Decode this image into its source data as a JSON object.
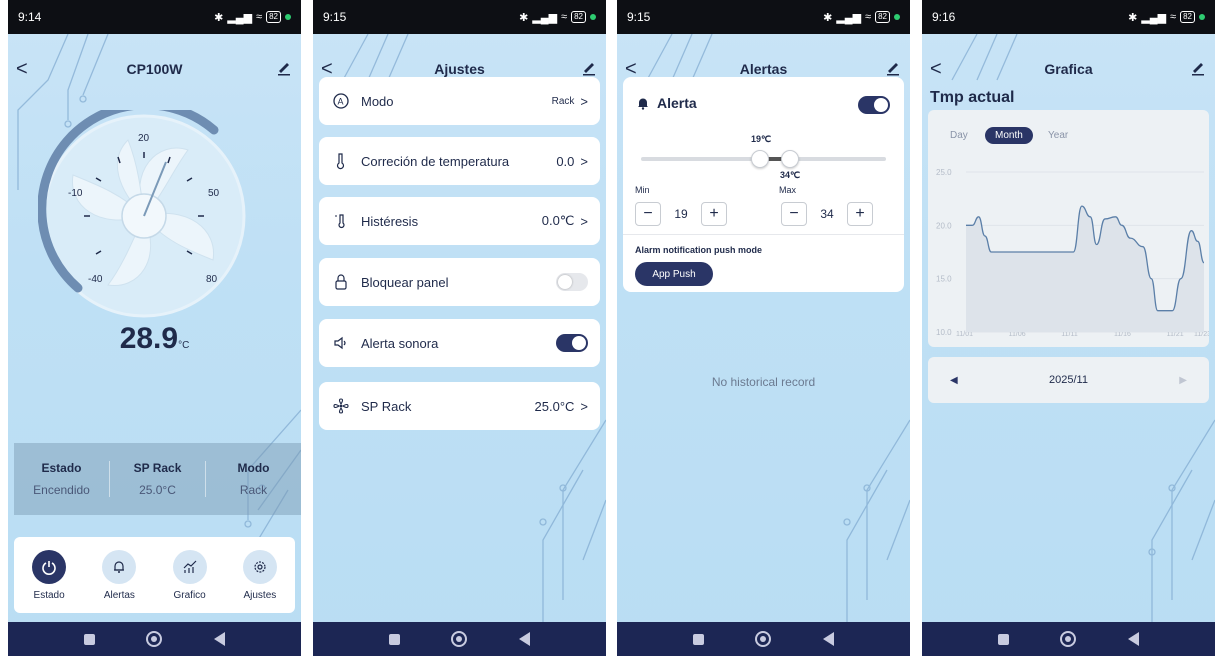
{
  "screens": [
    {
      "status": {
        "time": "9:14",
        "battery": "82"
      },
      "title": "CP100W",
      "dial": {
        "value": "28.9",
        "unit": "°C",
        "ticks": [
          "20",
          "-10",
          "50",
          "-40",
          "80"
        ]
      },
      "info": [
        {
          "label": "Estado",
          "value": "Encendido"
        },
        {
          "label": "SP Rack",
          "value": "25.0°C"
        },
        {
          "label": "Modo",
          "value": "Rack"
        }
      ],
      "tabs": [
        {
          "label": "Estado",
          "icon": "power-icon",
          "active": true
        },
        {
          "label": "Alertas",
          "icon": "bell-icon",
          "active": false
        },
        {
          "label": "Grafico",
          "icon": "chart-icon",
          "active": false
        },
        {
          "label": "Ajustes",
          "icon": "gear-icon",
          "active": false
        }
      ]
    },
    {
      "status": {
        "time": "9:15",
        "battery": "82"
      },
      "title": "Ajustes",
      "settings": [
        {
          "label": "Modo",
          "value": "Rack",
          "icon": "mode-icon",
          "type": "link"
        },
        {
          "label": "Correción de temperatura",
          "value": "0.0",
          "icon": "temperature-icon",
          "type": "link"
        },
        {
          "label": "Histéresis",
          "value": "0.0℃",
          "icon": "hysteresis-icon",
          "type": "link"
        },
        {
          "label": "Bloquear panel",
          "icon": "lock-icon",
          "type": "toggle",
          "on": false
        },
        {
          "label": "Alerta sonora",
          "icon": "speaker-icon",
          "type": "toggle",
          "on": true
        },
        {
          "label": "SP Rack",
          "value": "25.0°C",
          "icon": "fan-icon",
          "type": "link"
        }
      ]
    },
    {
      "status": {
        "time": "9:15",
        "battery": "82"
      },
      "title": "Alertas",
      "alert": {
        "title": "Alerta",
        "enabled": true,
        "low_thumb": "19℃",
        "high_thumb": "34℃",
        "min_label": "Min",
        "max_label": "Max",
        "min_value": "19",
        "max_value": "34",
        "push_label": "Alarm notification push mode",
        "push_button": "App Push"
      },
      "empty_text": "No historical record"
    },
    {
      "status": {
        "time": "9:16",
        "battery": "82"
      },
      "title": "Grafica",
      "section": "Tmp actual",
      "segments": [
        "Day",
        "Month",
        "Year"
      ],
      "active_segment": "Month",
      "period": "2025/11",
      "chart_data": {
        "type": "area",
        "title": "",
        "xlabel": "",
        "ylabel": "",
        "y_ticks": [
          "25.0",
          "20.0",
          "15.0",
          "10.0"
        ],
        "ylim": [
          10,
          25
        ],
        "x_ticks": [
          "11/01",
          "11/06",
          "11/11",
          "11/16",
          "11/21",
          "11/23"
        ],
        "x": [
          0,
          0.6,
          1.2,
          1.8,
          2.4,
          3,
          6,
          9.6,
          10.2,
          11,
          11.8,
          12.4,
          13.2,
          14.2,
          14.8,
          15.6,
          16.8,
          17.6,
          18.2,
          19,
          19.6,
          20.4,
          21.4,
          22,
          22.6
        ],
        "values": [
          20.0,
          20.0,
          20.8,
          19.0,
          17.5,
          17.5,
          17.5,
          17.5,
          17.5,
          21.8,
          20.8,
          18.2,
          20.6,
          20.8,
          20.0,
          18.8,
          18.0,
          15.0,
          12.0,
          12.0,
          12.0,
          15.0,
          19.5,
          18.5,
          16.5
        ],
        "color": "#5b7fa8"
      }
    }
  ]
}
